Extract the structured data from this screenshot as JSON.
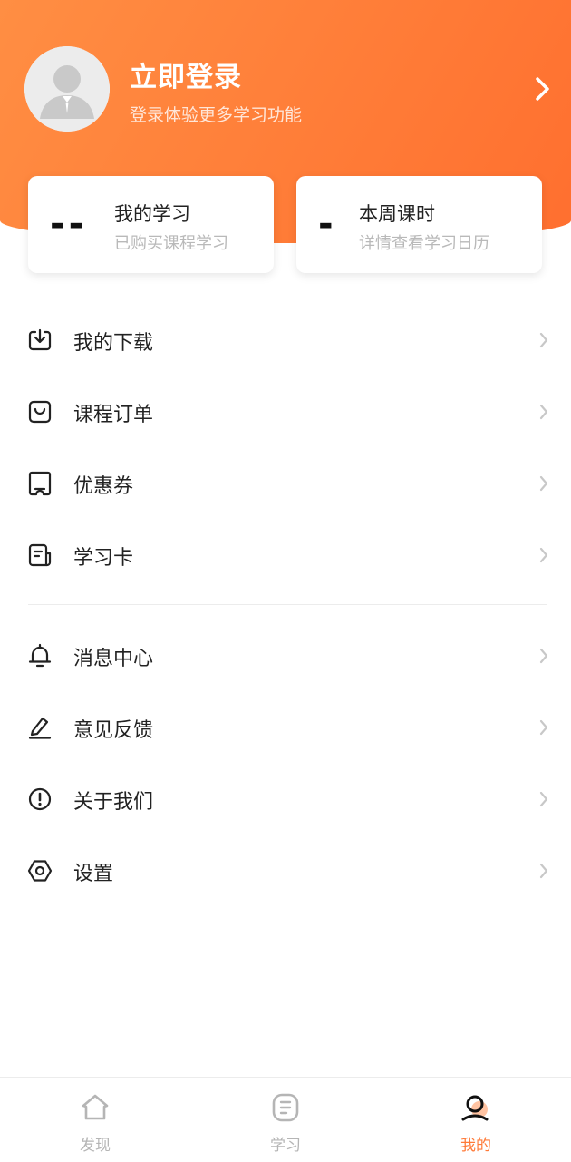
{
  "profile": {
    "title": "立即登录",
    "subtitle": "登录体验更多学习功能"
  },
  "cards": [
    {
      "value": "--",
      "title": "我的学习",
      "subtitle": "已购买课程学习"
    },
    {
      "value": "-",
      "title": "本周课时",
      "subtitle": "详情查看学习日历"
    }
  ],
  "menu_group1": [
    {
      "label": "我的下载",
      "icon": "download-icon"
    },
    {
      "label": "课程订单",
      "icon": "shopping-bag-icon"
    },
    {
      "label": "优惠券",
      "icon": "coupon-icon"
    },
    {
      "label": "学习卡",
      "icon": "card-icon"
    }
  ],
  "menu_group2": [
    {
      "label": "消息中心",
      "icon": "bell-icon"
    },
    {
      "label": "意见反馈",
      "icon": "edit-icon"
    },
    {
      "label": "关于我们",
      "icon": "info-icon"
    },
    {
      "label": "设置",
      "icon": "gear-icon"
    }
  ],
  "tabs": [
    {
      "label": "发现",
      "icon": "home-icon"
    },
    {
      "label": "学习",
      "icon": "document-icon"
    },
    {
      "label": "我的",
      "icon": "user-icon",
      "active": true
    }
  ],
  "colors": {
    "accent": "#ff7a38",
    "header_start": "#ff8e43",
    "header_end": "#ff6f2f"
  }
}
